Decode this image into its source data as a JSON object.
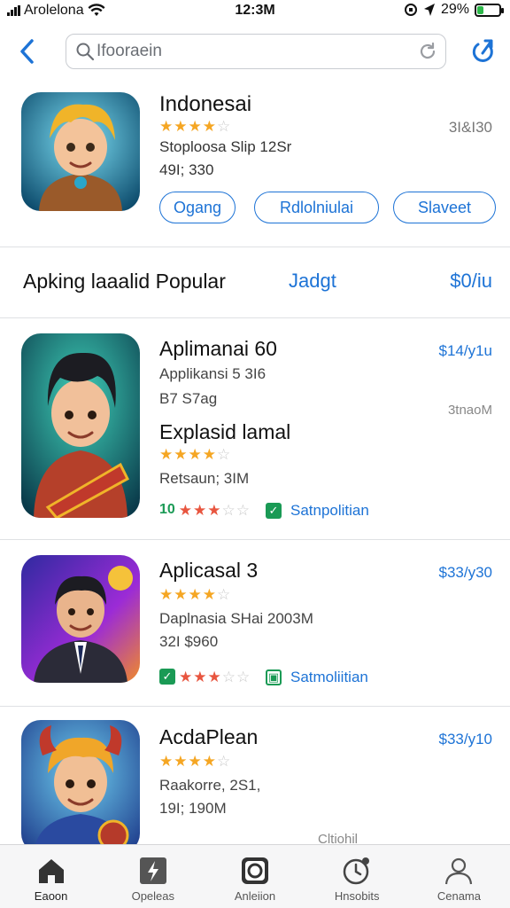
{
  "status_bar": {
    "carrier": "Arolelona",
    "time": "12:3M",
    "battery": "29%",
    "battery_level": 0.29
  },
  "search": {
    "placeholder": "Ifooraein"
  },
  "featured": {
    "title": "Indonesai",
    "rating": 4,
    "price": "3I&I30",
    "line1": "Stoploosa Slip 12Sr",
    "line2": "49I; 330",
    "buttons": [
      "Ogang",
      "Rdlolniulai",
      "Slaveet"
    ]
  },
  "section": {
    "title": "Apking laaalid Popular",
    "link": "Jadgt",
    "price": "$0/iu"
  },
  "apps": [
    {
      "title": "Aplimanai 60",
      "price": "$14/y1u",
      "sub": "Applikansi 5 3I6",
      "sub2": "B7 S7ag",
      "meta": "3tnaoM",
      "heading2": "Explasid lamal",
      "rating": 4,
      "sub3": "Retsaun; 3IM",
      "row_rating": 3,
      "row_prefix": "10",
      "link": "Satnpolitian"
    },
    {
      "title": "Aplicasal 3",
      "price": "$33/y30",
      "rating": 4,
      "sub": "Daplnasia SHai 2003M",
      "sub2": "32I $960",
      "row_rating": 3,
      "link": "Satmoliitian"
    },
    {
      "title": "AcdaPlean",
      "price": "$33/y10",
      "rating": 4,
      "sub": "Raakorre, 2S1,",
      "sub2": "19I; 190M",
      "meta": "Cltiohil"
    }
  ],
  "tabs": [
    {
      "label": "Eaoon",
      "icon": "home-icon"
    },
    {
      "label": "Opeleas",
      "icon": "spark-square-icon"
    },
    {
      "label": "Anleiion",
      "icon": "camera-frame-icon"
    },
    {
      "label": "Hnsobits",
      "icon": "clock-badge-icon"
    },
    {
      "label": "Cenama",
      "icon": "person-icon"
    }
  ],
  "colors": {
    "accent": "#1d73d6",
    "star": "#f5a623",
    "star_red": "#e8553f",
    "green": "#1a9a55"
  }
}
